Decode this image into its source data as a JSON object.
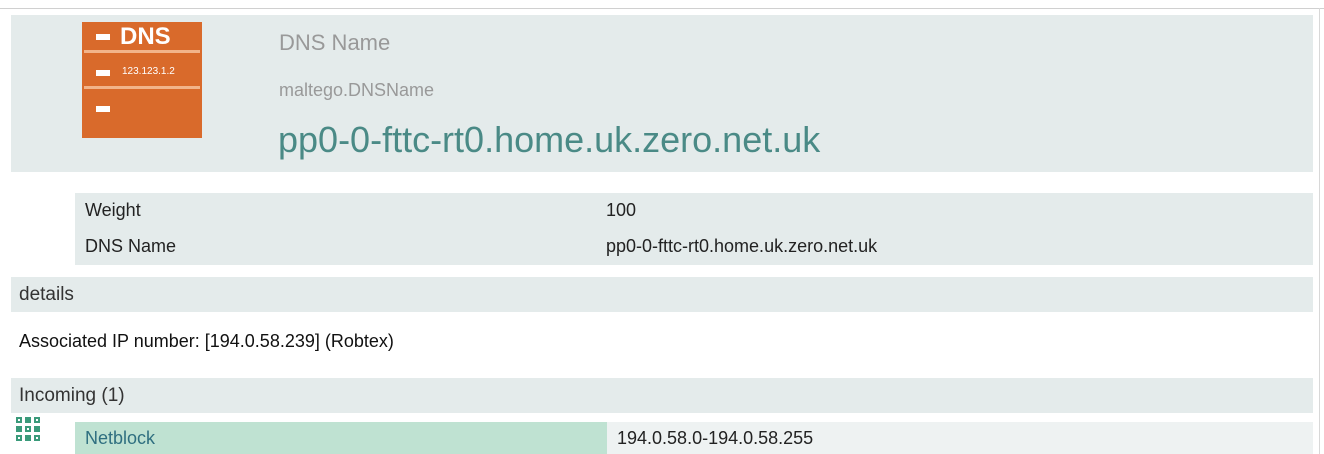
{
  "entity": {
    "type_label": "DNS Name",
    "type_id": "maltego.DNSName",
    "value": "pp0-0-fttc-rt0.home.uk.zero.net.uk",
    "icon": {
      "name": "dns-server-icon",
      "label": "DNS",
      "sublabel": "123.123.1.2",
      "color": "#d96a2b"
    }
  },
  "properties": [
    {
      "key": "Weight",
      "value": "100"
    },
    {
      "key": "DNS Name",
      "value": "pp0-0-fttc-rt0.home.uk.zero.net.uk"
    }
  ],
  "details": {
    "title": "details",
    "text": "Associated IP number: [194.0.58.239] (Robtex)"
  },
  "incoming": {
    "title": "Incoming (1)",
    "items": [
      {
        "icon": "netblock-icon",
        "type": "Netblock",
        "value": "194.0.58.0-194.0.58.255"
      }
    ]
  },
  "colors": {
    "panel_bg": "#e4ebeb",
    "entity_value": "#4a8a86",
    "muted_text": "#999999",
    "incoming_highlight": "#bfe2d2",
    "netblock_icon": "#3a9a7a"
  }
}
